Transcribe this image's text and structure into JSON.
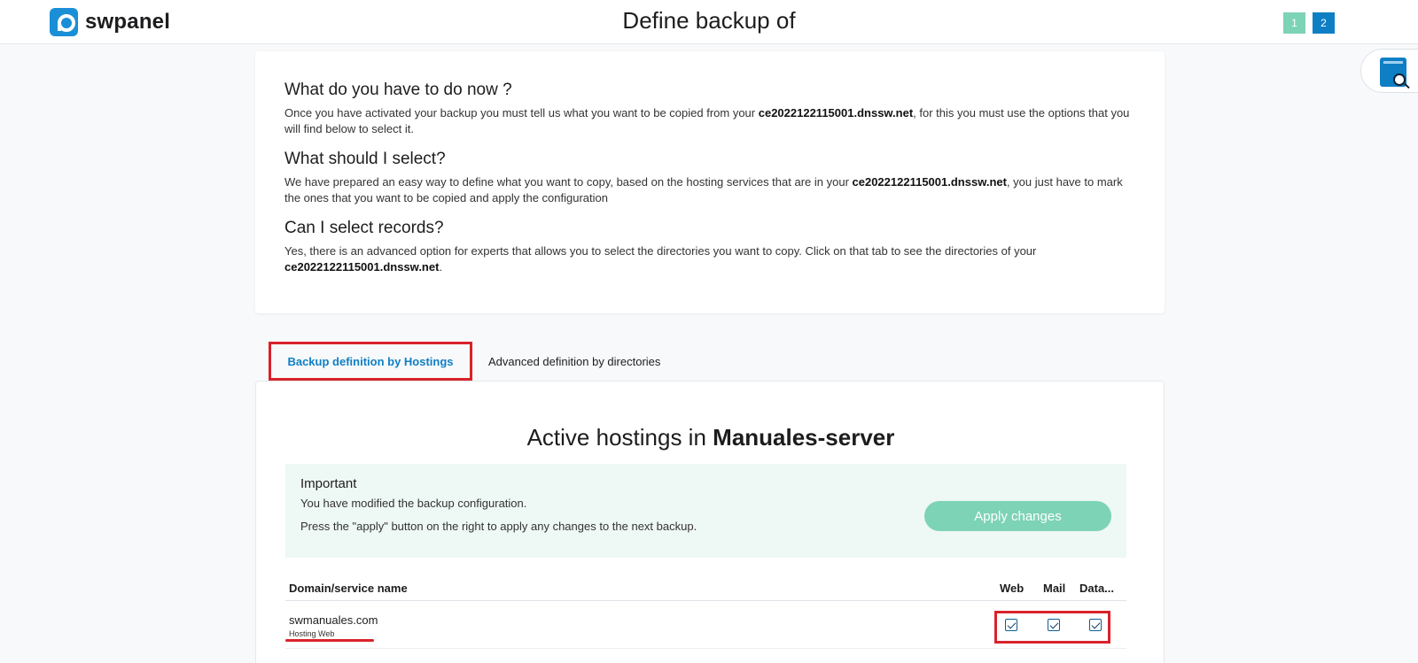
{
  "header": {
    "logo_text": "swpanel",
    "title": "Define backup of",
    "steps": [
      "1",
      "2"
    ],
    "colors": {
      "brand": "#1a8fd8",
      "step_done": "#7dd3b5",
      "step_active": "#0e7fc4"
    }
  },
  "help": {
    "icon": "book-search-icon"
  },
  "info": {
    "q1": "What do you have to do now ?",
    "a1_pre": "Once you have activated your backup you must tell us what you want to be copied from your ",
    "a1_host": "ce2022122115001.dnssw.net",
    "a1_post": ", for this you must use the options that you will find below to select it.",
    "q2": "What should I select?",
    "a2_pre": "We have prepared an easy way to define what you want to copy, based on the hosting services that are in your ",
    "a2_host": "ce2022122115001.dnssw.net",
    "a2_post": ", you just have to mark the ones that you want to be copied and apply the configuration",
    "q3": "Can I select records?",
    "a3_pre": "Yes, there is an advanced option for experts that allows you to select the directories you want to copy. Click on that tab to see the directories of your ",
    "a3_host": "ce2022122115001.dnssw.net",
    "a3_post": "."
  },
  "tabs": {
    "hostings": "Backup definition by Hostings",
    "directories": "Advanced definition by directories"
  },
  "section": {
    "title_pre": "Active hostings in ",
    "title_server": "Manuales-server"
  },
  "notice": {
    "title": "Important",
    "line1": "You have modified the backup configuration.",
    "line2": "Press the \"apply\" button on the right to apply any changes to the next backup.",
    "apply_label": "Apply changes"
  },
  "table": {
    "headers": {
      "domain": "Domain/service name",
      "web": "Web",
      "mail": "Mail",
      "data": "Data..."
    },
    "rows": [
      {
        "domain": "swmanuales.com",
        "type": "Hosting Web",
        "web": true,
        "mail": true,
        "data": true
      }
    ]
  },
  "colors": {
    "highlight": "#d9222a",
    "accent": "#0e7fc4",
    "success": "#7dd3b5"
  }
}
